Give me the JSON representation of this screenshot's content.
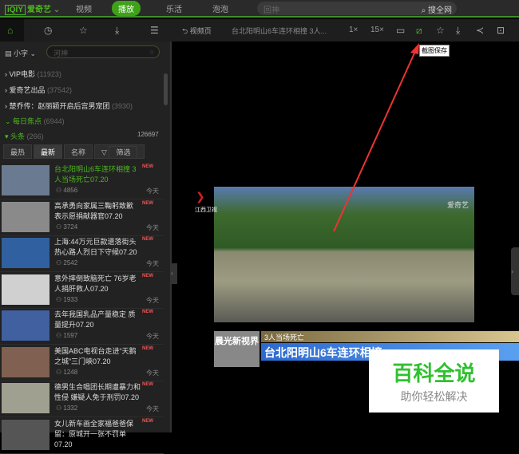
{
  "top": {
    "logo_mark": "iQIY",
    "logo": "爱奇艺",
    "nav": [
      "视频",
      "播放",
      "乐活",
      "泡泡"
    ],
    "search_placeholder": "回神",
    "search_btn": "搜全网"
  },
  "toolbar": {
    "back": "视频页",
    "title": "台北阳明山6车连环相撞 3人...",
    "speed1": "1×",
    "speed2": "15×",
    "tooltip": "截图保存"
  },
  "sidebar": {
    "font": "小字",
    "search_placeholder": "河神",
    "categories": [
      {
        "label": "VIP电影",
        "count": "(11923)"
      },
      {
        "label": "爱奇艺出品",
        "count": "(37542)"
      },
      {
        "label": "楚乔传：赵丽颖开启后宫男宠团",
        "count": "(3930)"
      },
      {
        "label": "每日焦点",
        "count": "(6944)"
      },
      {
        "label": "头条",
        "count": "(266)"
      }
    ],
    "total": "126697",
    "sort": [
      "最热",
      "最新",
      "名称",
      "筛选"
    ],
    "items": [
      {
        "title": "台北阳明山6车连环相撞 3人当场死亡07.20",
        "views": "4856",
        "date": "今天"
      },
      {
        "title": "高承勇向家属三鞠躬致歉 表示愿捐献器官07.20",
        "views": "3724",
        "date": "今天"
      },
      {
        "title": "上海:44万元巨款遗落街头 热心路人烈日下守候07.20",
        "views": "2542",
        "date": "今天"
      },
      {
        "title": "意外摔倒致脑死亡 76岁老人捐肝救人07.20",
        "views": "1933",
        "date": "今天"
      },
      {
        "title": "去年我国乳品产量稳定 质量提升07.20",
        "views": "1597",
        "date": "今天"
      },
      {
        "title": "美国ABC电视台走进“天鹅之城”三门峡07.20",
        "views": "1248",
        "date": "今天"
      },
      {
        "title": "德男生合唱团长期遭暴力和性侵 嫌疑人免于刑罚07.20",
        "views": "1332",
        "date": "今天"
      },
      {
        "title": "女儿新车画全家福爸爸保留：原城开一张不罚单07.20",
        "views": "",
        "date": ""
      }
    ]
  },
  "video": {
    "station": "江西卫视",
    "watermark": "爱奇艺",
    "show": "晨光新视界",
    "sub": "3人当场死亡",
    "headline": "台北阳明山6车连环相撞"
  },
  "overlay": {
    "title": "百科全说",
    "subtitle": "助你轻松解决"
  },
  "badge_new": "NEW"
}
